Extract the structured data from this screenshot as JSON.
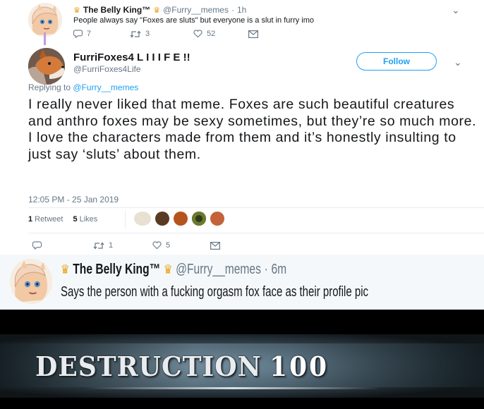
{
  "tweet1": {
    "display_name": "The Belly King™",
    "handle": "@Furry__memes",
    "separator": "·",
    "time": "1h",
    "text": "People always say \"Foxes are sluts\" but everyone is a slut in furry imo",
    "replies": "7",
    "retweets": "3",
    "likes": "52"
  },
  "main_tweet": {
    "display_name": "FurriFoxes4 L I I I F E !!",
    "handle": "@FurriFoxes4Life",
    "follow_label": "Follow",
    "replying_prefix": "Replying to",
    "replying_handle": "@Furry__memes",
    "text": "I really never liked that meme. Foxes are such beautiful creatures and anthro foxes may be sexy sometimes, but they’re so much more. I love the characters made from them and it’s honestly insulting to just say ‘sluts’ about them.",
    "timestamp": "12:05 PM - 25 Jan 2019",
    "retweet_count": "1",
    "retweet_label": "Retweet",
    "like_count": "5",
    "like_label": "Likes",
    "action_retweets": "1",
    "action_likes": "5"
  },
  "tweet3": {
    "display_name": "The Belly King™",
    "handle": "@Furry__memes",
    "separator": "·",
    "time": "6m",
    "text": "Says the person with a fucking orgasm fox face as their profile pic"
  },
  "banner": {
    "word": "DESTRUCTION",
    "number": "100"
  },
  "colors": {
    "accent": "#1da1f2",
    "muted": "#657786",
    "crown": "#e8a31a",
    "thread_line": "#c69ad6"
  }
}
